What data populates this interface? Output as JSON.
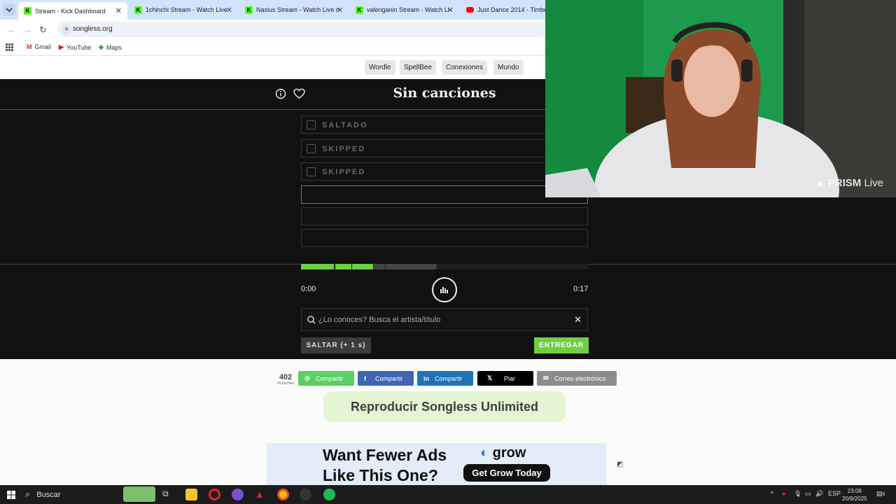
{
  "browser": {
    "tabs": [
      {
        "title": "Stream - Kick Dashboard",
        "favicon": "kick-icon",
        "active": true
      },
      {
        "title": "1chinchi Stream - Watch Live o",
        "favicon": "kick-icon",
        "active": false
      },
      {
        "title": "Nasius Stream - Watch Live on",
        "favicon": "kick-icon",
        "active": false
      },
      {
        "title": "valenganin Stream - Watch Live",
        "favicon": "kick-icon",
        "active": false
      },
      {
        "title": "Just Dance 2014 - Timber -",
        "favicon": "youtube-icon",
        "active": false
      }
    ],
    "url": "songless.org",
    "bookmarks": [
      {
        "label": "Gmail",
        "icon": "gmail-icon"
      },
      {
        "label": "YouTube",
        "icon": "youtube-icon"
      },
      {
        "label": "Maps",
        "icon": "maps-icon"
      }
    ]
  },
  "site_nav": {
    "items": [
      "Wordle",
      "SpellBee",
      "Conexiones",
      "Mundo"
    ]
  },
  "game": {
    "title": "Sin canciones",
    "guesses": [
      {
        "text": "SALTADO",
        "state": "skipped"
      },
      {
        "text": "SKIPPED",
        "state": "skipped"
      },
      {
        "text": "SKIPPED",
        "state": "skipped"
      },
      {
        "text": "",
        "state": "current"
      },
      {
        "text": "",
        "state": "empty"
      },
      {
        "text": "",
        "state": "empty"
      }
    ],
    "time_start": "0:00",
    "time_end": "0:17",
    "search_placeholder": "¿Lo conoces? Busca el artista/título",
    "skip_label": "SALTAR (+ 1 s)",
    "submit_label": "ENTREGAR",
    "colors": {
      "accent": "#6ed03f",
      "background": "#111111"
    }
  },
  "share": {
    "count": "402",
    "count_label": "Acciones",
    "buttons": [
      {
        "label": "Compartir",
        "icon": "whatsapp-icon",
        "color": "#57d163"
      },
      {
        "label": "Compartir",
        "icon": "facebook-icon",
        "color": "#3f66b5"
      },
      {
        "label": "Compartir",
        "icon": "linkedin-icon",
        "color": "#1d73b6"
      },
      {
        "label": "Piar",
        "icon": "x-icon",
        "color": "#000000"
      },
      {
        "label": "Correo electrónico",
        "icon": "email-icon",
        "color": "#8c8c8c"
      }
    ]
  },
  "unlimited_label": "Reproducir Songless Unlimited",
  "ad": {
    "headline_1": "Want Fewer Ads",
    "headline_2": "Like This One?",
    "brand": "grow",
    "cta": "Get Grow Today"
  },
  "webcam": {
    "overlay_brand": "PRISM",
    "overlay_suffix": "Live"
  },
  "taskbar": {
    "search_label": "Buscar",
    "language": "ESP",
    "time": "23:08",
    "date": "20/9/2025",
    "notification_count": "6"
  }
}
